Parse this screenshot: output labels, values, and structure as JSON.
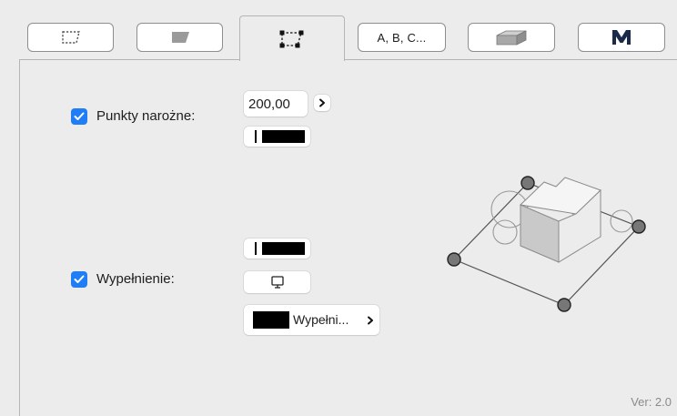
{
  "tabs": [
    {
      "icon": "dashed-quad-icon"
    },
    {
      "icon": "filled-quad-icon"
    },
    {
      "icon": "corner-points-icon",
      "active": true
    },
    {
      "label": "A, B, C..."
    },
    {
      "icon": "3d-block-icon"
    },
    {
      "icon": "m-logo-icon",
      "label": "M"
    }
  ],
  "corner_points": {
    "checkbox_label": "Punkty narożne:",
    "checked": true,
    "value": "200,00"
  },
  "fill": {
    "checkbox_label": "Wypełnienie:",
    "checked": true,
    "fill_button_label": "Wypełni..."
  },
  "version": "Ver: 2.0",
  "colors": {
    "accent": "#1f7ef5",
    "background": "#ececec"
  }
}
